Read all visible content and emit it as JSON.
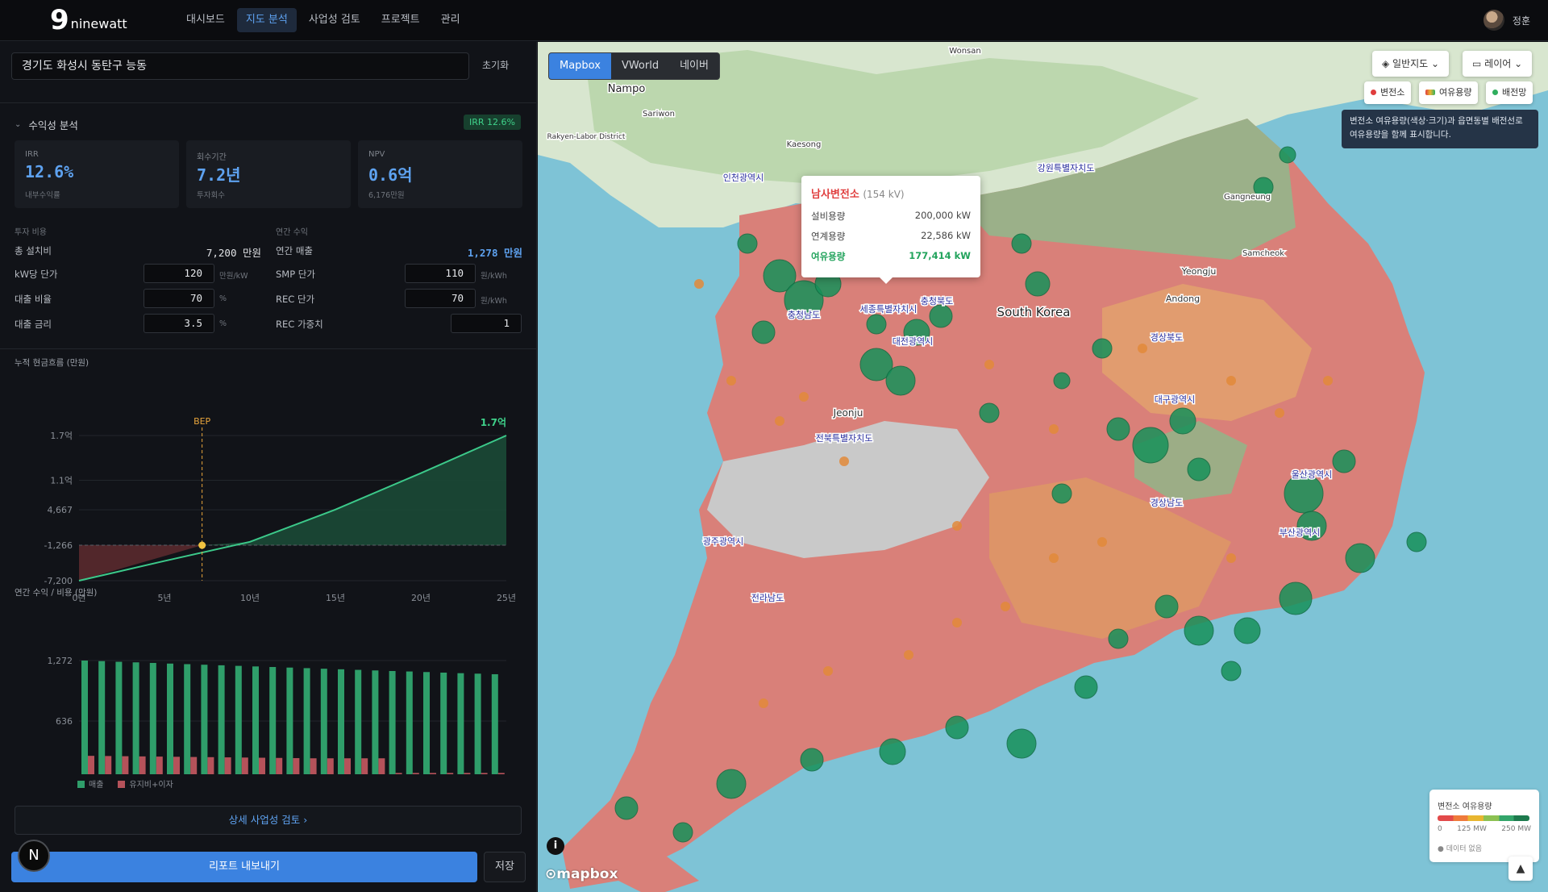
{
  "app": {
    "logo_mark": "9",
    "logo_text": "ninewatt",
    "user_name": "정훈"
  },
  "nav": [
    {
      "label": "대시보드"
    },
    {
      "label": "지도 분석"
    },
    {
      "label": "사업성 검토"
    },
    {
      "label": "프로젝트"
    },
    {
      "label": "관리"
    }
  ],
  "left": {
    "address": "경기도 화성시 동탄구 능동",
    "reset_label": "초기화",
    "section_title": "수익성 분석",
    "irr_badge": "IRR 12.6%",
    "kpis": [
      {
        "label": "IRR",
        "value": "12.6%",
        "sub": "내부수익률"
      },
      {
        "label": "회수기간",
        "value": "7.2년",
        "sub": "투자회수"
      },
      {
        "label": "NPV",
        "value": "0.6억",
        "sub": "6,176만원"
      }
    ],
    "invest_group": "투자 비용",
    "revenue_group": "연간 수익",
    "total_cost_label": "총 설치비",
    "total_cost_value": "7,200 만원",
    "annual_rev_label": "연간 매출",
    "annual_rev_value": "1,278 만원",
    "left_fields": [
      {
        "label": "kW당 단가",
        "value": "120",
        "unit": "만원/kW"
      },
      {
        "label": "대출 비율",
        "value": "70",
        "unit": "%"
      },
      {
        "label": "대출 금리",
        "value": "3.5",
        "unit": "%"
      }
    ],
    "right_fields": [
      {
        "label": "SMP 단가",
        "value": "110",
        "unit": "원/kWh"
      },
      {
        "label": "REC 단가",
        "value": "70",
        "unit": "원/kWh"
      },
      {
        "label": "REC 가중치",
        "value": "1",
        "unit": ""
      }
    ],
    "detail_button": "상세 사업성 검토  ›",
    "export_button": "리포트 내보내기",
    "save_button": "저장",
    "n_badge": "N"
  },
  "chart_data": [
    {
      "type": "area",
      "title": "누적 현금흐름 (만원)",
      "x_ticks": [
        "0년",
        "5년",
        "10년",
        "15년",
        "20년",
        "25년"
      ],
      "y_ticks": [
        "1.7억",
        "1.1억",
        "4,667",
        "-1,266",
        "-7,200"
      ],
      "x": [
        0,
        5,
        10,
        15,
        20,
        25
      ],
      "values": [
        -7200,
        -3900,
        -700,
        4700,
        10800,
        17100
      ],
      "ylim": [
        -7200,
        17100
      ],
      "bep_label": "BEP",
      "bep_x": 7.2,
      "end_label": "1.7억"
    },
    {
      "type": "bar",
      "title": "연간 수익 / 비용 (만원)",
      "x_ticks": [
        "5년",
        "10년",
        "15년",
        "20년",
        "25년"
      ],
      "y_ticks": [
        "1,272",
        "636",
        "0"
      ],
      "ylim": [
        0,
        1272
      ],
      "series": [
        {
          "name": "매출",
          "color": "#2f9e6a",
          "values": [
            1272,
            1266,
            1259,
            1253,
            1247,
            1240,
            1234,
            1228,
            1222,
            1216,
            1210,
            1204,
            1198,
            1192,
            1186,
            1180,
            1174,
            1168,
            1162,
            1157,
            1151,
            1145,
            1139,
            1134,
            1128
          ]
        },
        {
          "name": "유지비+이자",
          "color": "#b5525a",
          "values": [
            270,
            268,
            266,
            264,
            262,
            260,
            258,
            256,
            254,
            252,
            250,
            248,
            246,
            244,
            244,
            244,
            244,
            244,
            90,
            90,
            90,
            90,
            90,
            90,
            90
          ]
        }
      ]
    }
  ],
  "map": {
    "tabs": [
      {
        "label": "Mapbox"
      },
      {
        "label": "VWorld"
      },
      {
        "label": "네이버"
      }
    ],
    "basemap_button": "일반지도",
    "layer_button": "레이어",
    "chips": [
      {
        "label": "변전소",
        "color": "#e03e3e"
      },
      {
        "label": "여유용량",
        "color": "#e8b630"
      },
      {
        "label": "배전망",
        "color": "#2fae5e"
      }
    ],
    "tip": "변전소 여유용량(색상·크기)과 읍면동별 배전선로 여유용량을 함께 표시합니다.",
    "popup": {
      "title": "남사변전소",
      "voltage": "(154 kV)",
      "rows": [
        {
          "k": "설비용량",
          "v": "200,000 kW"
        },
        {
          "k": "연계용량",
          "v": "22,586 kW"
        },
        {
          "k": "여유용량",
          "v": "177,414 kW"
        }
      ]
    },
    "legend": {
      "title": "변전소 여유용량",
      "ticks": [
        "0",
        "125 MW",
        "250 MW"
      ],
      "no_data": "데이터 없음"
    },
    "labels": [
      {
        "t": "Nampo"
      },
      {
        "t": "Sariwon"
      },
      {
        "t": "Rakyen-Labor District"
      },
      {
        "t": "Kaesong"
      },
      {
        "t": "Wonsan"
      },
      {
        "t": "인천광역시"
      },
      {
        "t": "강원특별자치도"
      },
      {
        "t": "충청북도"
      },
      {
        "t": "세종특별자치시"
      },
      {
        "t": "충청남도"
      },
      {
        "t": "대전광역시"
      },
      {
        "t": "South Korea"
      },
      {
        "t": "경상북도"
      },
      {
        "t": "대구광역시"
      },
      {
        "t": "전북특별자치도"
      },
      {
        "t": "울산광역시"
      },
      {
        "t": "경상남도"
      },
      {
        "t": "부산광역시"
      },
      {
        "t": "광주광역시"
      },
      {
        "t": "전라남도"
      },
      {
        "t": "Jeonju"
      },
      {
        "t": "Andong"
      },
      {
        "t": "Yeongju"
      },
      {
        "t": "Gangneung"
      },
      {
        "t": "Samcheok"
      }
    ],
    "attribution": "mapbox",
    "info": "i"
  }
}
